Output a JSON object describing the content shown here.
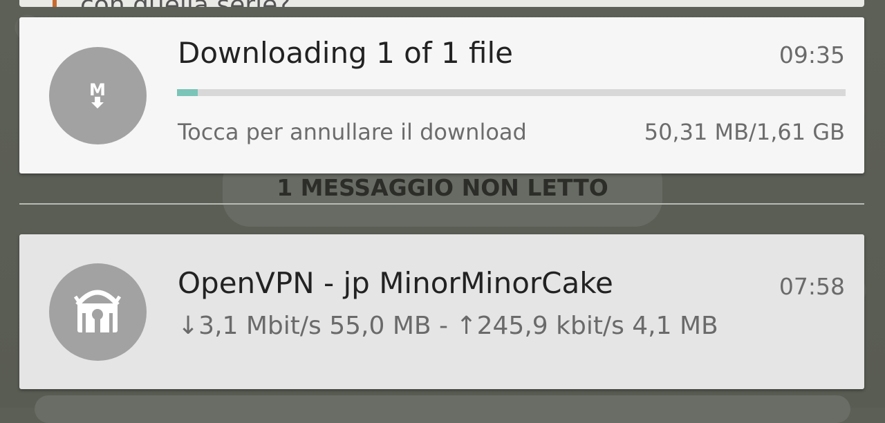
{
  "background_chat": {
    "partial_text": "con quella serie?"
  },
  "download_notification": {
    "app_icon": "mega-download-icon",
    "title": "Downloading 1 of 1 file",
    "time": "09:35",
    "progress_fraction": 0.031,
    "subtitle": "Tocca per annullare il download",
    "size": "50,31 MB/1,61 GB",
    "accent_color": "#7ac4b8"
  },
  "unread_separator": {
    "label": "1 MESSAGGIO NON LETTO"
  },
  "vpn_notification": {
    "app_icon": "openvpn-icon",
    "title": "OpenVPN - jp MinorMinorCake",
    "time": "07:58",
    "stats": "↓3,1 Mbit/s 55,0 MB - ↑245,9 kbit/s 4,1 MB"
  }
}
